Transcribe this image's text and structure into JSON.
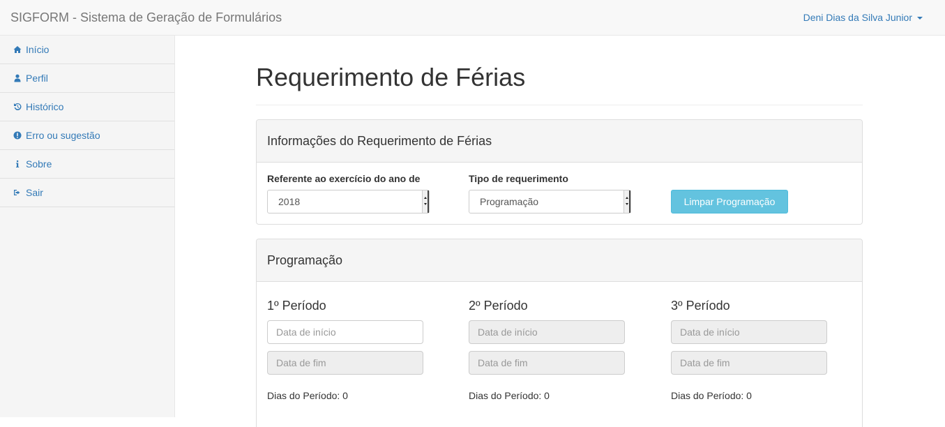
{
  "navbar": {
    "brand": "SIGFORM - Sistema de Geração de Formulários",
    "user": "Deni Dias da Silva Junior"
  },
  "sidebar": {
    "items": [
      {
        "label": "Início",
        "icon": "home-icon"
      },
      {
        "label": "Perfil",
        "icon": "user-icon"
      },
      {
        "label": "Histórico",
        "icon": "history-icon"
      },
      {
        "label": "Erro ou sugestão",
        "icon": "exclamation-icon"
      },
      {
        "label": "Sobre",
        "icon": "info-icon"
      },
      {
        "label": "Sair",
        "icon": "logout-icon"
      }
    ]
  },
  "page": {
    "title": "Requerimento de Férias"
  },
  "info_panel": {
    "heading": "Informações do Requerimento de Férias",
    "year_label": "Referente ao exercício do ano de",
    "year_value": "2018",
    "type_label": "Tipo de requerimento",
    "type_value": "Programação",
    "clear_button": "Limpar Programação"
  },
  "programacao_panel": {
    "heading": "Programação",
    "periods": [
      {
        "title": "1º Período",
        "start_placeholder": "Data de início",
        "end_placeholder": "Data de fim",
        "days": "Dias do Período: 0"
      },
      {
        "title": "2º Período",
        "start_placeholder": "Data de início",
        "end_placeholder": "Data de fim",
        "days": "Dias do Período: 0"
      },
      {
        "title": "3º Período",
        "start_placeholder": "Data de início",
        "end_placeholder": "Data de fim",
        "days": "Dias do Período: 0"
      }
    ]
  },
  "colors": {
    "link": "#337ab7",
    "info_button": "#5bc0de"
  }
}
